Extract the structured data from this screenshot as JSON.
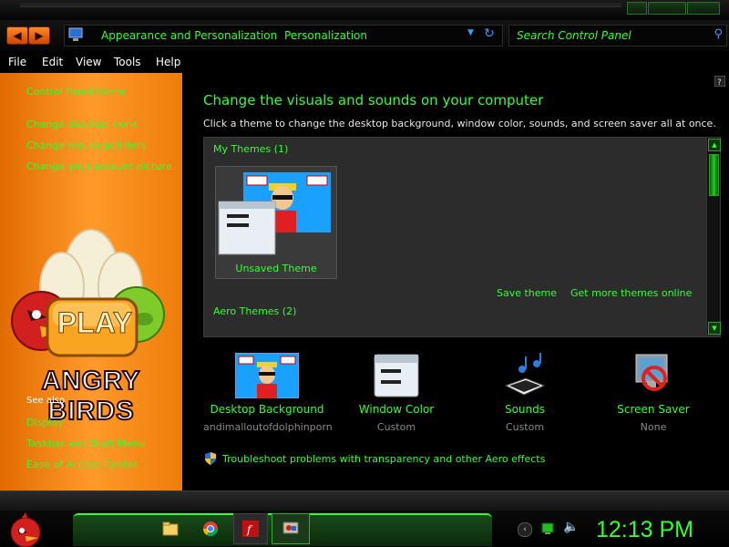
{
  "colors": {
    "accent": "#33ff33",
    "sidebar_orange": "#f07d0a",
    "panel_bg": "#2c2c2c"
  },
  "addressbar": {
    "back_icon": "back-arrow-icon",
    "forward_icon": "forward-arrow-icon",
    "crumbs": [
      "Appearance and Personalization",
      "Personalization"
    ],
    "search_placeholder": "Search Control Panel"
  },
  "menu": [
    "File",
    "Edit",
    "View",
    "Tools",
    "Help"
  ],
  "sidebar": {
    "home": "Control Panel Home",
    "links": [
      "Change desktop icons",
      "Change mouse pointers",
      "Change your account picture"
    ],
    "see_also": "See also",
    "see_also_links": [
      "Display",
      "Taskbar and Start Menu",
      "Ease of Access Center"
    ],
    "logo_play": "PLAY",
    "logo_title": "ANGRY BIRDS"
  },
  "main": {
    "heading": "Change the visuals and sounds on your computer",
    "subtext": "Click a theme to change the desktop background, window color, sounds, and screen saver all at once.",
    "my_themes": "My Themes (1)",
    "theme_name": "Unsaved Theme",
    "save_theme": "Save theme",
    "more_themes": "Get more themes online",
    "aero_themes": "Aero Themes (2)"
  },
  "bottom": [
    {
      "label": "Desktop Background",
      "value": "andimalloutofdolphinporn",
      "icon": "desktop-background-icon"
    },
    {
      "label": "Window Color",
      "value": "Custom",
      "icon": "window-color-icon"
    },
    {
      "label": "Sounds",
      "value": "Custom",
      "icon": "sounds-icon"
    },
    {
      "label": "Screen Saver",
      "value": "None",
      "icon": "screen-saver-icon"
    }
  ],
  "troubleshoot": "Troubleshoot problems with transparency and other Aero effects",
  "taskbar": {
    "clock": "12:13 PM"
  }
}
